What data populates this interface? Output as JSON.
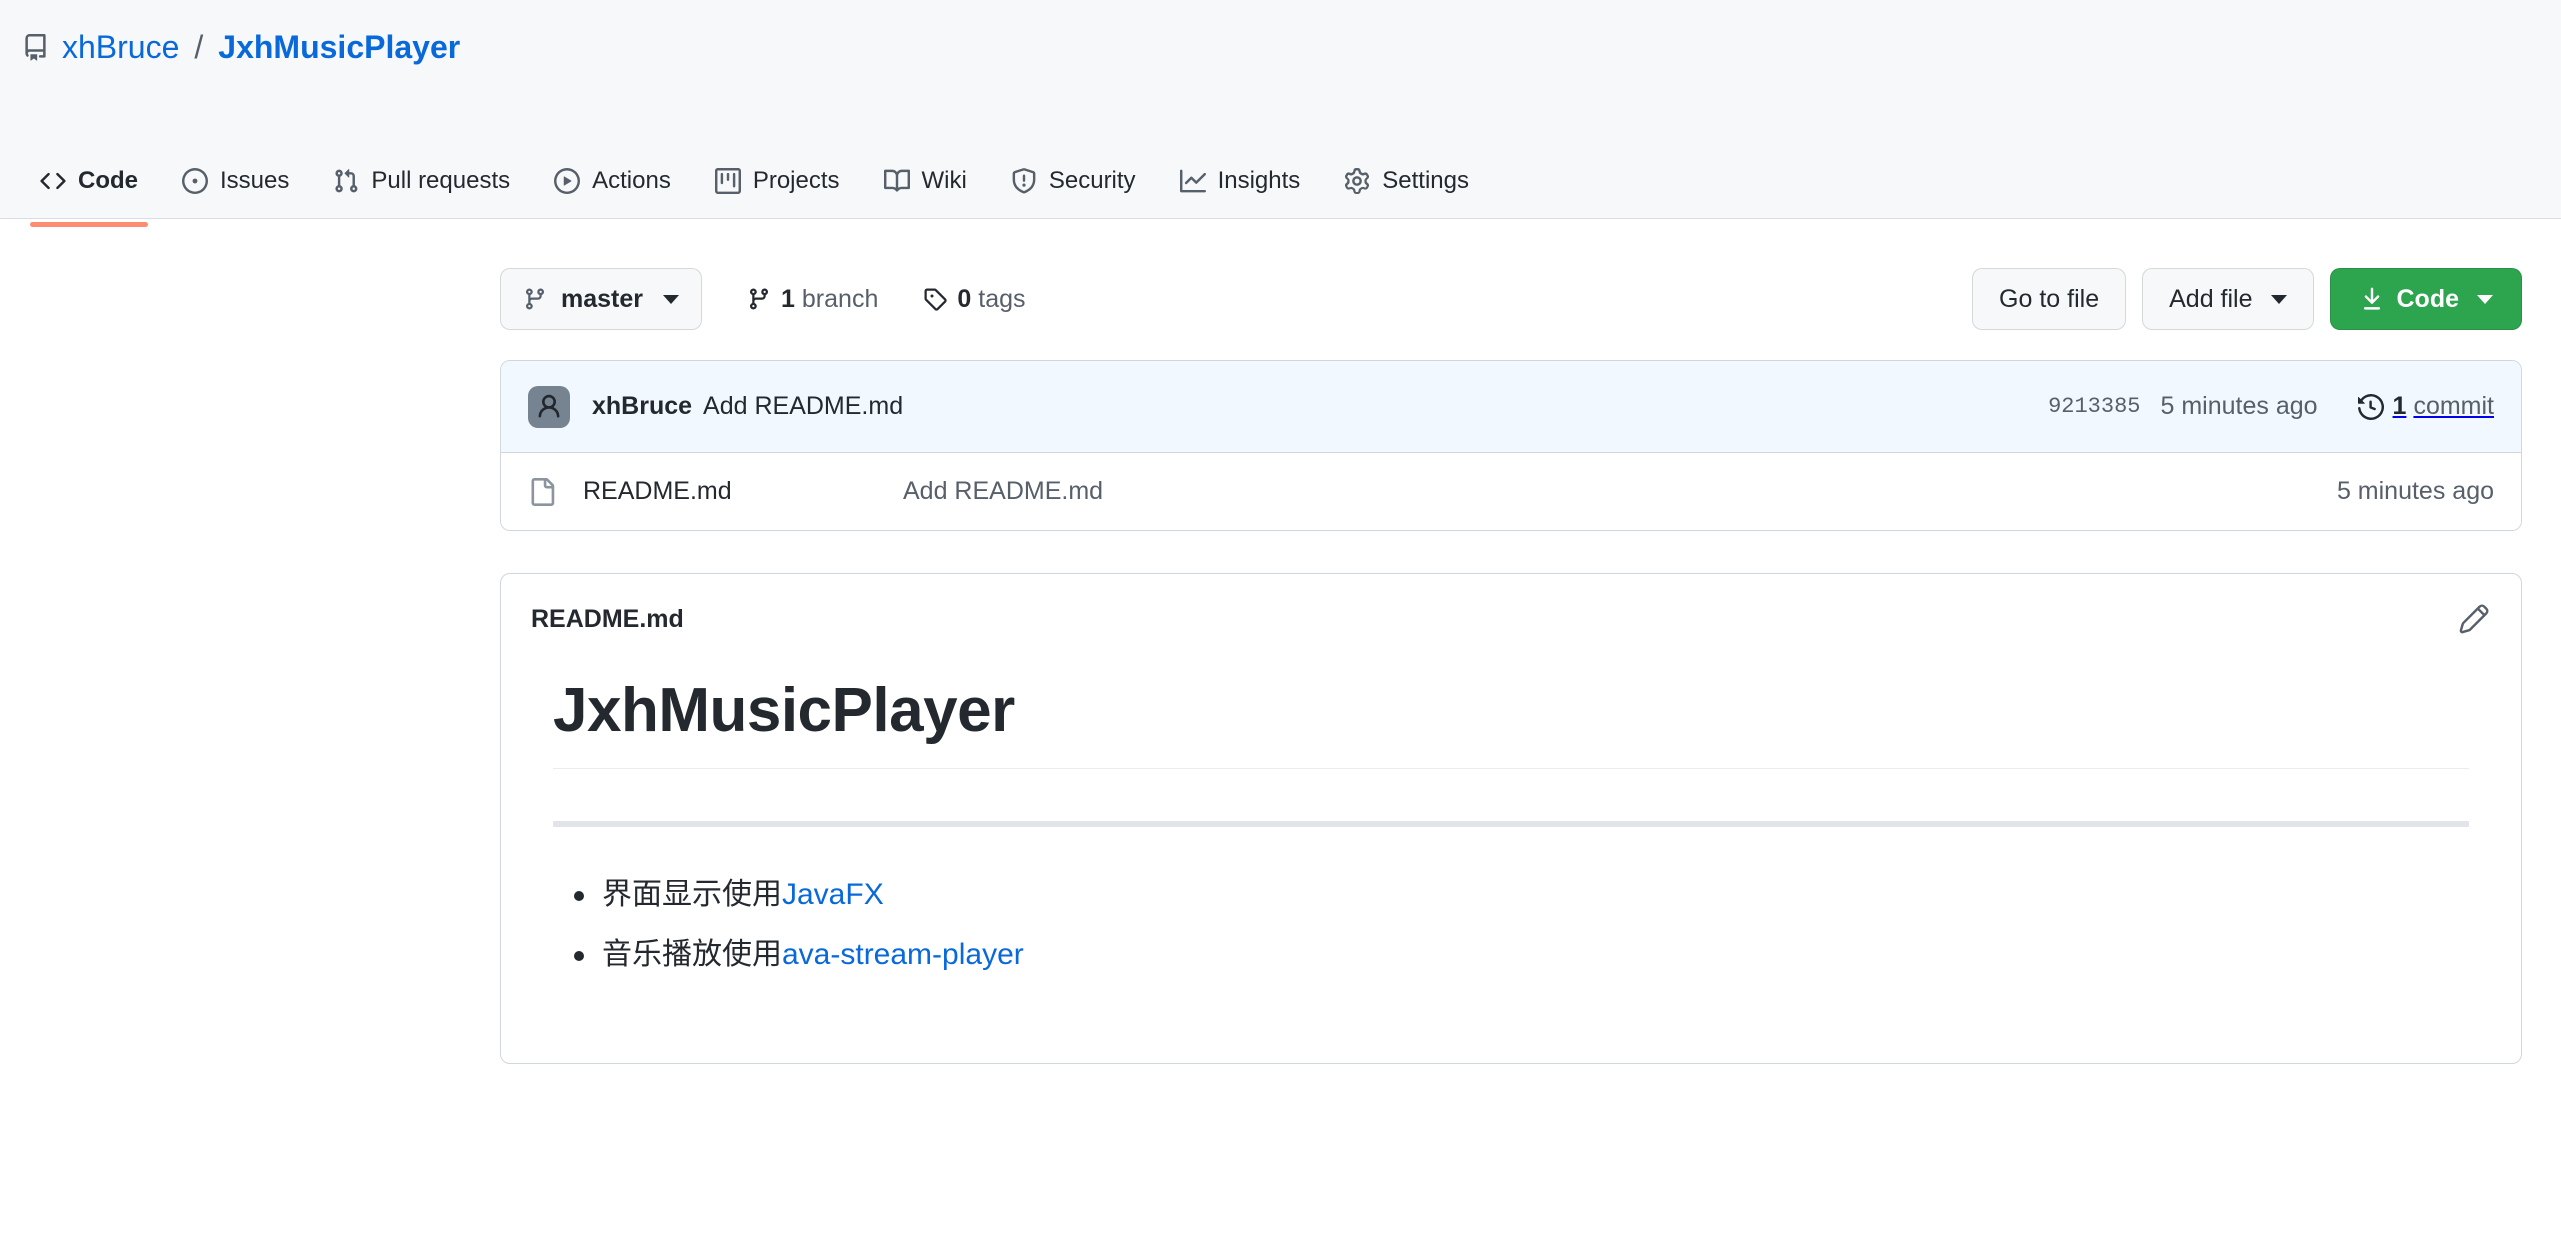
{
  "repo": {
    "icon": "repo-icon",
    "owner": "xhBruce",
    "separator": "/",
    "name": "JxhMusicPlayer"
  },
  "nav": {
    "items": [
      {
        "label": "Code",
        "icon": "code-icon",
        "active": true
      },
      {
        "label": "Issues",
        "icon": "issue-opened-icon",
        "active": false
      },
      {
        "label": "Pull requests",
        "icon": "git-pull-request-icon",
        "active": false
      },
      {
        "label": "Actions",
        "icon": "play-icon",
        "active": false
      },
      {
        "label": "Projects",
        "icon": "project-icon",
        "active": false
      },
      {
        "label": "Wiki",
        "icon": "book-icon",
        "active": false
      },
      {
        "label": "Security",
        "icon": "shield-icon",
        "active": false
      },
      {
        "label": "Insights",
        "icon": "graph-icon",
        "active": false
      },
      {
        "label": "Settings",
        "icon": "gear-icon",
        "active": false
      }
    ]
  },
  "toolbar": {
    "branch": "master",
    "branch_count_num": "1",
    "branch_count_word": "branch",
    "tag_count_num": "0",
    "tag_count_word": "tags",
    "go_to_file_label": "Go to file",
    "add_file_label": "Add file",
    "code_label": "Code"
  },
  "commit": {
    "author": "xhBruce",
    "message": "Add README.md",
    "sha": "9213385",
    "time": "5 minutes ago",
    "count_num": "1",
    "count_word": "commit"
  },
  "files": [
    {
      "name": "README.md",
      "commit_message": "Add README.md",
      "time": "5 minutes ago",
      "icon": "file-icon"
    }
  ],
  "readme": {
    "title": "README.md",
    "edit_icon": "pencil-icon",
    "heading": "JxhMusicPlayer",
    "bullets": [
      {
        "text": "界面显示使用",
        "link": "JavaFX"
      },
      {
        "text": "音乐播放使用",
        "link": "ava-stream-player"
      }
    ]
  },
  "colors": {
    "header_bg": "#f6f8fa",
    "link": "#0969da",
    "active_tab_underline": "#fd8c73",
    "primary_button": "#2da44e",
    "commit_row_bg": "#f1f8ff",
    "border": "#d0d7de",
    "muted_text": "#57606a",
    "text": "#24292f"
  }
}
